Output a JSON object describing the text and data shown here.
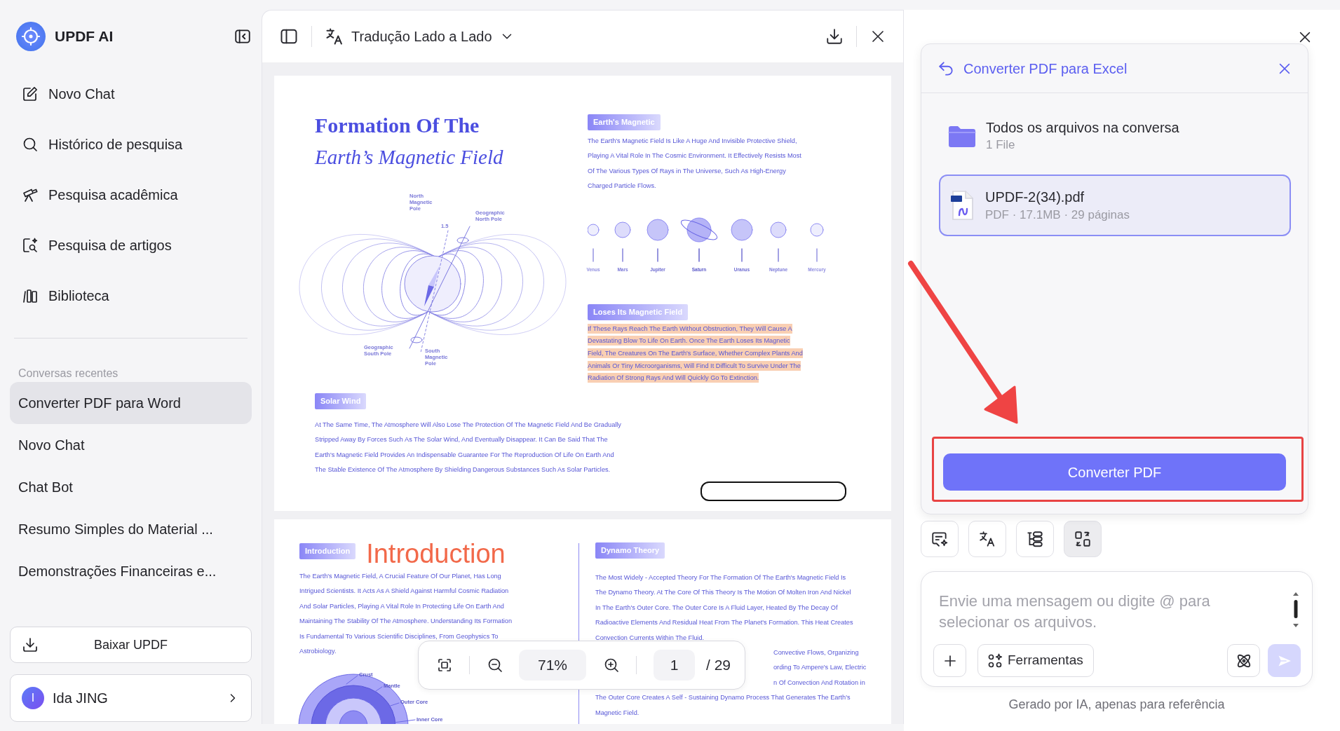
{
  "sidebar": {
    "app_name": "UPDF AI",
    "nav": [
      "Novo Chat",
      "Histórico de pesquisa",
      "Pesquisa acadêmica",
      "Pesquisa de artigos",
      "Biblioteca"
    ],
    "recent_heading": "Conversas recentes",
    "recent": [
      {
        "label": "Converter PDF para Word",
        "selected": true
      },
      {
        "label": "Novo Chat",
        "selected": false
      },
      {
        "label": "Chat Bot",
        "selected": false
      },
      {
        "label": "Resumo Simples do Material ...",
        "selected": false
      },
      {
        "label": "Demonstrações Financeiras e...",
        "selected": false
      }
    ],
    "download_button": "Baixar UPDF",
    "user": {
      "initial": "I",
      "name": "Ida JING"
    }
  },
  "viewer": {
    "title": "Tradução Lado a Lado",
    "page_1": {
      "title": "Formation Of The",
      "subtitle": "Earth’s Magnetic Field",
      "diagram_labels": [
        "North Magnetic Pole",
        "Geographic North Pole",
        "1.5",
        "Geographic South Pole",
        "South Magnetic Pole"
      ],
      "magnetic_section": {
        "tag": "Earth's Magnetic",
        "highlighted": false,
        "lines": [
          "The Earth's Magnetic Field Is Like A Huge And Invisible Protective Shield,",
          "Playing A Vital Role In The Cosmic Environment. It Effectively Resists Most",
          "Of The Various Types Of Rays in The Universe, Such As High-Energy",
          "Charged Particle Flows."
        ]
      },
      "planets": [
        "Venus",
        "Mars",
        "Jupiter",
        "Saturn",
        "Uranus",
        "Neptune",
        "Mercury"
      ],
      "loss_section": {
        "tag": "Loses Its Magnetic Field",
        "highlighted": true,
        "lines": [
          "If These Rays Reach The Earth Without Obstruction, They Will Cause A",
          "Devastating Blow To Life On Earth. Once The Earth Loses Its Magnetic",
          "Field, The Creatures On The Earth's Surface, Whether Complex Plants And",
          "Animals Or Tiny Microorganisms, Will Find It Difficult To Survive Under The",
          "Radiation Of Strong Rays And Will Quickly Go To Extinction."
        ]
      },
      "solar_section": {
        "tag": "Solar Wind",
        "highlighted": false,
        "lines": [
          "At The Same Time, The Atmosphere Will Also Lose The Protection Of The Magnetic Field And Be Gradually",
          "Stripped Away By Forces Such As The Solar Wind, And Eventually Disappear. It Can Be Said That The",
          "Earth's Magnetic Field Provides An Indispensable Guarantee For The Reproduction Of Life On Earth And",
          "The Stable Existence Of The Atmosphere By Shielding Dangerous Substances Such As Solar Particles."
        ]
      }
    },
    "page_2": {
      "intro": {
        "tag": "Introduction",
        "heading": "Introduction",
        "lines": [
          "The Earth's Magnetic Field, A Crucial Feature Of Our Planet, Has Long",
          "Intrigued Scientists. It Acts As A Shield Against Harmful Cosmic Radiation",
          "And Solar Particles, Playing A Vital Role In Protecting Life On Earth And",
          "Maintaining The Stability Of The Atmosphere. Understanding Its Formation",
          "Is Fundamental To Various Scientific Disciplines, From Geophysics To",
          "Astrobiology."
        ],
        "layer_labels": [
          "Crust",
          "Mantle",
          "Outer Core",
          "Inner Core"
        ]
      },
      "dynamo": {
        "tag": "Dynamo Theory",
        "lines": [
          "The Most Widely - Accepted Theory For The Formation Of The Earth's Magnetic Field Is",
          "The Dynamo Theory. At The Core Of This Theory Is The Motion Of Molten Iron And Nickel",
          "In The Earth's Outer Core. The Outer Core Is A Fluid Layer, Heated By The Decay Of",
          "Radioactive Elements And Residual Heat From The Planet's Formation. This Heat Creates",
          "Convection Currents Within The Fluid."
        ],
        "partial_lines": [
          "Convective Flows, Organizing",
          "ording To Ampere's Law, Electric",
          "n Of Convection And Rotation in"
        ],
        "lines_2": [
          "The Outer Core Creates A Self - Sustaining Dynamo Process That Generates The Earth's",
          "Magnetic Field."
        ]
      }
    },
    "zoom_bar": {
      "zoom": "71%",
      "page": "1",
      "page_total": "/ 29"
    }
  },
  "convert_panel": {
    "title": "Converter PDF para Excel",
    "folder": {
      "name": "Todos os arquivos na conversa",
      "count": "1 File"
    },
    "files": [
      {
        "name": "UPDF-2(34).pdf",
        "meta": "PDF · 17.1MB · 29 páginas",
        "selected": true
      }
    ],
    "button": "Converter PDF"
  },
  "tools": [
    {
      "selected": false
    },
    {
      "selected": false
    },
    {
      "selected": false
    },
    {
      "selected": true
    }
  ],
  "composer": {
    "placeholder": "Envie uma mensagem ou digite @ para selecionar os arquivos.",
    "tools_button": "Ferramentas"
  },
  "footer": "Gerado por IA, apenas para referência"
}
